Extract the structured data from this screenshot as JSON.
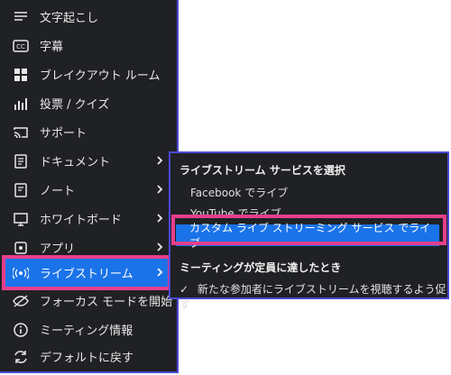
{
  "menu": {
    "items": [
      {
        "label": "文字起こし"
      },
      {
        "label": "字幕"
      },
      {
        "label": "ブレイクアウト ルーム"
      },
      {
        "label": "投票 / クイズ"
      },
      {
        "label": "サポート"
      },
      {
        "label": "ドキュメント"
      },
      {
        "label": "ノート"
      },
      {
        "label": "ホワイトボード"
      },
      {
        "label": "アプリ"
      },
      {
        "label": "ライブストリーム"
      },
      {
        "label": "フォーカス モードを開始"
      },
      {
        "label": "ミーティング情報"
      },
      {
        "label": "デフォルトに戻す"
      }
    ]
  },
  "submenu": {
    "heading1": "ライブストリーム サービスを選択",
    "options": [
      "Facebook でライブ",
      "YouTube でライブ",
      "カスタム ライブ ストリーミング サービス でライブ"
    ],
    "heading2": "ミーティングが定員に達したとき",
    "check_label": "新たな参加者にライブストリームを視聴するよう促す"
  },
  "colors": {
    "background": "#202124",
    "accent": "#1a73e8",
    "highlight": "#e83e8c",
    "frame": "#4a4ad6"
  },
  "icons": [
    "transcript-icon",
    "cc-icon",
    "grid-icon",
    "poll-icon",
    "cast-icon",
    "document-icon",
    "note-icon",
    "whiteboard-icon",
    "apps-icon",
    "livestream-icon",
    "focus-icon",
    "info-icon",
    "reset-icon",
    "chevron-right-icon",
    "check-icon"
  ]
}
